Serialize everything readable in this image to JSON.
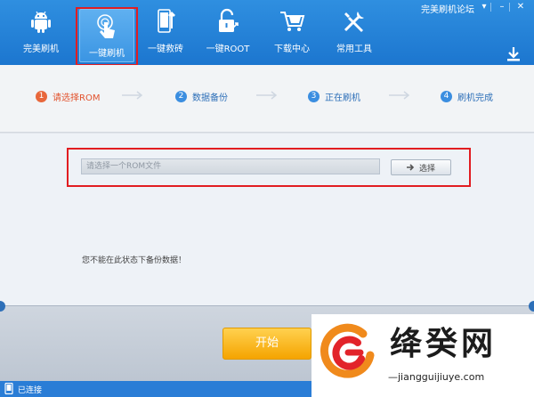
{
  "window": {
    "forum_link": "完美刷机论坛",
    "menu_glyph": "▾",
    "min_glyph": "–",
    "close_glyph": "✕"
  },
  "toolbar": {
    "items": [
      {
        "label": "完美刷机",
        "icon": "android-icon"
      },
      {
        "label": "一键刷机",
        "icon": "hand-touch-icon",
        "active": true
      },
      {
        "label": "一键救砖",
        "icon": "phone-wrench-icon"
      },
      {
        "label": "一键ROOT",
        "icon": "unlock-icon"
      },
      {
        "label": "下载中心",
        "icon": "shopping-cart-icon"
      },
      {
        "label": "常用工具",
        "icon": "tools-icon"
      }
    ]
  },
  "steps": [
    {
      "num": "1",
      "label": "请选择ROM",
      "current": true
    },
    {
      "num": "2",
      "label": "数据备份"
    },
    {
      "num": "3",
      "label": "正在刷机"
    },
    {
      "num": "4",
      "label": "刷机完成"
    }
  ],
  "rom": {
    "placeholder": "请选择一个ROM文件",
    "choose_label": "选择"
  },
  "warning": "您不能在此状态下备份数据！",
  "start_label": "开始",
  "status": {
    "text": "已连接"
  },
  "watermark": {
    "title": "绛癸网",
    "subtitle": "—jiangguijiuye.com"
  },
  "colors": {
    "toolbar_blue": "#1c76cf",
    "step_active": "#e8673b",
    "step_blue": "#3b8ee0",
    "start_orange": "#f5a400",
    "highlight_red": "#e11d21"
  }
}
